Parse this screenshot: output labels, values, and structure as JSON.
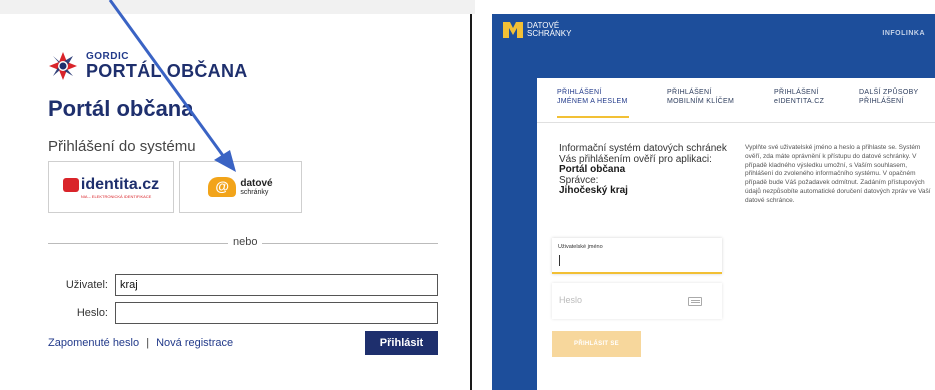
{
  "left": {
    "logo_small": "GORDIC",
    "logo_big": "PORTÁL OBČANA",
    "title": "Portál občana",
    "subtitle": "Přihlášení do systému",
    "idp1": {
      "name": "identita.cz",
      "tagline": "NIA – ELEKTRONICKÁ IDENTIFIKACE"
    },
    "idp2": {
      "line1": "datové",
      "line2": "schránky"
    },
    "divider": "nebo",
    "user_label": "Uživatel:",
    "user_value": "kraj",
    "pass_label": "Heslo:",
    "pass_value": "",
    "forgot": "Zapomenuté heslo",
    "separator": "|",
    "register": "Nová registrace",
    "submit": "Přihlásit",
    "colors": {
      "brand": "#1e2f6d",
      "arrow": "#3a63c4"
    }
  },
  "right": {
    "logo_line1": "DATOVÉ",
    "logo_line2": "SCHRÁNKY",
    "infolink": "INFOLINKA",
    "tabs": [
      {
        "l1": "PŘIHLÁŠENÍ",
        "l2": "JMÉNEM A HESLEM",
        "active": true
      },
      {
        "l1": "PŘIHLÁŠENÍ",
        "l2": "MOBILNÍM KLÍČEM"
      },
      {
        "l1": "PŘIHLÁŠENÍ",
        "l2": "eIDENTITA.CZ"
      },
      {
        "l1": "DALŠÍ ZPŮSOBY",
        "l2": "PŘIHLÁŠENÍ"
      }
    ],
    "info_left": {
      "text": "Informační systém datových schránek Vás přihlášením ověří pro aplikaci:",
      "app": "Portál občana",
      "admin_label": "Správce:",
      "admin": "Jihočeský kraj"
    },
    "info_right": "Vyplňte své uživatelské jméno a heslo a přihlaste se. Systém ověří, zda máte oprávnění k přístupu do datové schránky. V případě kladného výsledku umožní, s Vaším souhlasem, přihlášení do zvoleného informačního systému. V opačném případě bude Váš požadavek odmítnut. Zadáním přístupových údajů nezpůsobíte automatické doručení datových zpráv ve Vaší datové schránce.",
    "username_label": "Uživatelské jméno",
    "password_placeholder": "Heslo",
    "login_button": "PŘIHLÁSIT SE",
    "colors": {
      "blue": "#1d4e9b",
      "accent": "#f2c035",
      "button": "#f7d79c"
    }
  }
}
